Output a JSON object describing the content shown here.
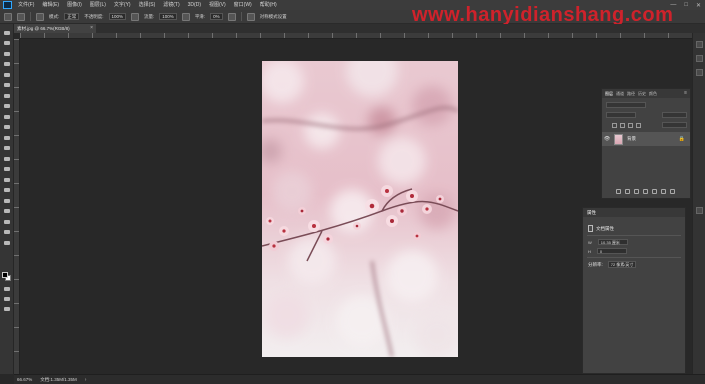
{
  "menu": {
    "items": [
      "文件(F)",
      "编辑(E)",
      "图像(I)",
      "图层(L)",
      "文字(Y)",
      "选择(S)",
      "滤镜(T)",
      "3D(D)",
      "视图(V)",
      "窗口(W)",
      "帮助(H)"
    ],
    "window_controls": [
      "—",
      "□",
      "✕"
    ]
  },
  "options": {
    "mode_label": "模式:",
    "mode_value": "正常",
    "opacity_label": "不透明度:",
    "opacity_value": "100%",
    "flow_label": "流量:",
    "flow_value": "100%",
    "smooth_label": "平滑:",
    "smooth_value": "0%",
    "last_label": "对称模式设置"
  },
  "watermark": "www.hanyidianshang.com",
  "document": {
    "tab_label": "素材.jpg @ 66.7%(RGB/8)",
    "tab_close": "×"
  },
  "layers_panel": {
    "tabs": [
      "图层",
      "通道",
      "路径",
      "历史",
      "颜色"
    ],
    "active_tab": "图层",
    "menu_glyph": "≡",
    "layer_name": "背景",
    "eye_glyph": "👁",
    "lock_glyph": "🔒"
  },
  "properties_panel": {
    "title": "属性",
    "doc_label": "文档属性",
    "width_label": "W",
    "width_value": "10.35 厘米",
    "height_label": "H",
    "height_value": "0",
    "res_label": "分辨率:",
    "res_value": "72 像素/英寸"
  },
  "status": {
    "zoom": "66.67%",
    "info": "文档:1.35M/1.35M",
    "arrow": "›"
  },
  "colors": {
    "accent": "#31a8ff",
    "watermark": "#e0202a",
    "canvas_bg": "#282828",
    "panel_bg": "#424242"
  }
}
